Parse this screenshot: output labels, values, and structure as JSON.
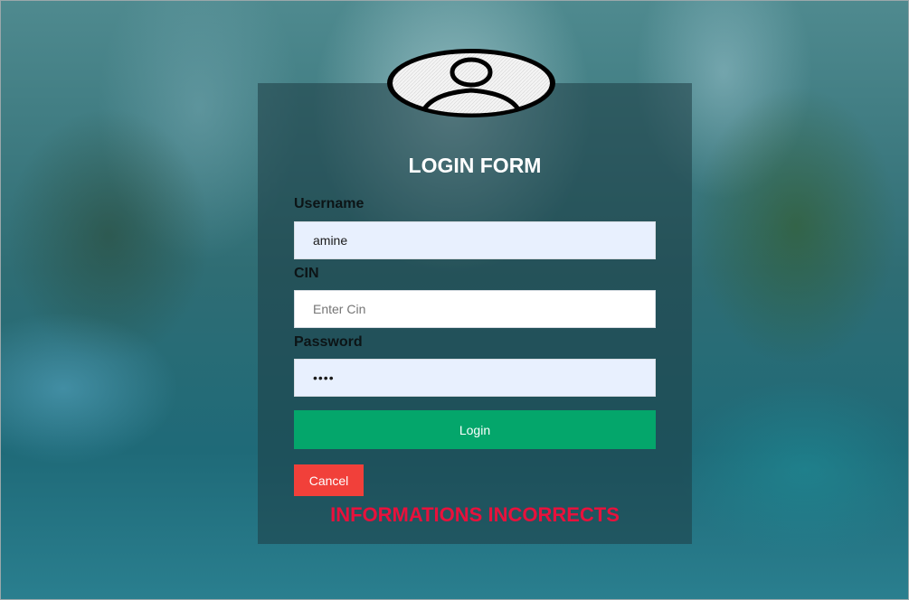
{
  "form": {
    "title": "LOGIN FORM",
    "username": {
      "label": "Username",
      "value": "amine",
      "placeholder": ""
    },
    "cin": {
      "label": "CIN",
      "value": "",
      "placeholder": "Enter Cin"
    },
    "password": {
      "label": "Password",
      "value": "••••",
      "placeholder": ""
    },
    "login_label": "Login",
    "cancel_label": "Cancel",
    "error_message": "INFORMATIONS INCORRECTS"
  },
  "icons": {
    "avatar": "user-avatar-icon"
  },
  "colors": {
    "login_button": "#04a66b",
    "cancel_button": "#f1403a",
    "error_text": "#e8113c",
    "autofill_bg": "#e8f0fe"
  }
}
